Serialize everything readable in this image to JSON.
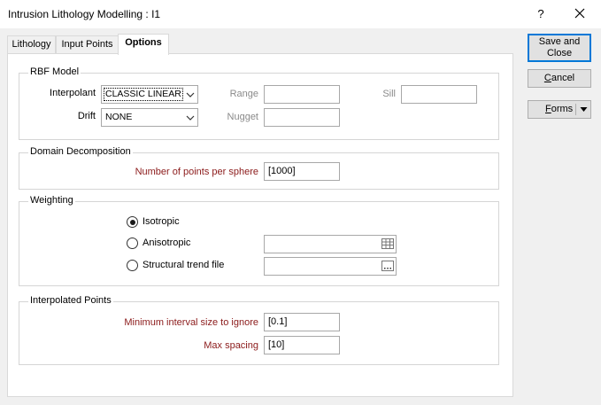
{
  "window": {
    "title": "Intrusion Lithology Modelling : I1",
    "help_label": "?"
  },
  "tabs": [
    {
      "label": "Lithology"
    },
    {
      "label": "Input Points"
    },
    {
      "label": "Options"
    }
  ],
  "rbf_model": {
    "title": "RBF Model",
    "interpolant_label": "Interpolant",
    "interpolant_value": "CLASSIC LINEAR",
    "drift_label": "Drift",
    "drift_value": "NONE",
    "range_label": "Range",
    "range_value": "",
    "sill_label": "Sill",
    "sill_value": "",
    "nugget_label": "Nugget",
    "nugget_value": ""
  },
  "domain_decomposition": {
    "title": "Domain Decomposition",
    "points_label": "Number of points per sphere",
    "points_value": "[1000]"
  },
  "weighting": {
    "title": "Weighting",
    "isotropic_label": "Isotropic",
    "anisotropic_label": "Anisotropic",
    "anisotropic_value": "",
    "trend_label": "Structural trend file",
    "trend_value": "",
    "selected": "Isotropic"
  },
  "interpolated_points": {
    "title": "Interpolated Points",
    "min_interval_label": "Minimum interval size to ignore",
    "min_interval_value": "[0.1]",
    "max_spacing_label": "Max spacing",
    "max_spacing_value": "[10]"
  },
  "buttons": {
    "save_close_line1": "Save and",
    "save_close_line2": "Close",
    "cancel_accel": "C",
    "cancel_rest": "ancel",
    "forms_accel": "F",
    "forms_rest": "orms"
  },
  "colors": {
    "required_label": "#8b1a1a",
    "disabled_label": "#8a8a8a",
    "default_button_border": "#0078d7"
  }
}
